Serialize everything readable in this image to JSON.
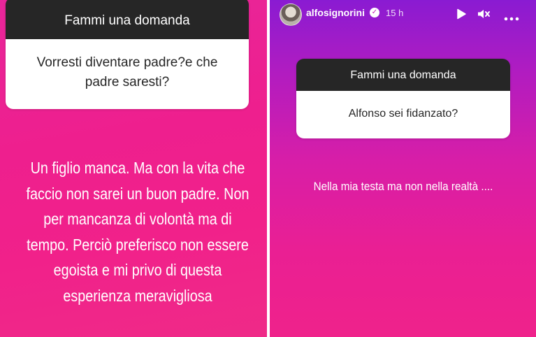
{
  "left_story": {
    "question_sticker": {
      "header": "Fammi una domanda",
      "question_line1": "Vorresti diventare padre?e che",
      "question_line2": "padre saresti?"
    },
    "answer_lines": [
      "Un figlio manca. Ma con la vita che",
      "faccio non sarei un buon padre. Non",
      "per mancanza di volontà ma di",
      "tempo. Perciò preferisco non essere",
      "egoista e mi privo di questa",
      "esperienza meravigliosa"
    ]
  },
  "right_story": {
    "header": {
      "username": "alfosignorini",
      "time": "15 h",
      "icons": [
        "verified-badge-icon",
        "play-icon",
        "mute-icon",
        "more-icon"
      ]
    },
    "question_sticker": {
      "header": "Fammi una domanda",
      "question": "Alfonso sei fidanzato?"
    },
    "answer": "Nella mia testa ma non nella realtà ...."
  },
  "colors": {
    "left_background": "#ef218c",
    "right_background_top": "#8a1bd2",
    "right_background_bottom": "#ef228b",
    "sticker_header": "#262626",
    "sticker_body": "#ffffff"
  }
}
